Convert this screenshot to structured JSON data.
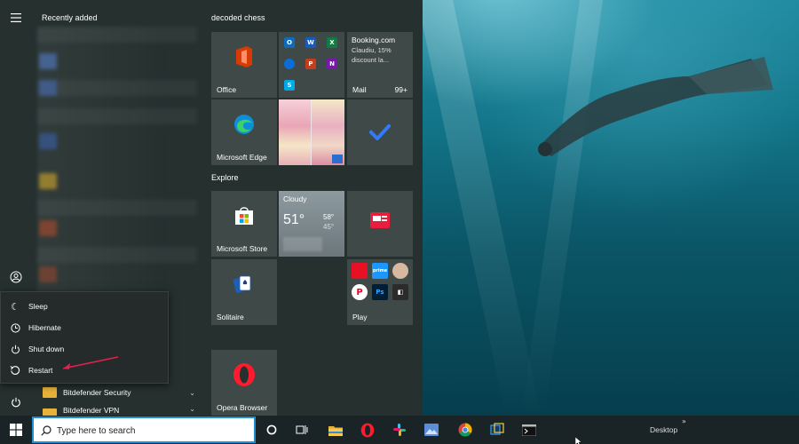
{
  "start_menu": {
    "recent_title": "Recently added",
    "group_decoded": "decoded chess",
    "group_explore": "Explore",
    "tiles": {
      "office": "Office",
      "mail": "Mail",
      "mail_count": "99+",
      "booking_title": "Booking.com",
      "booking_line1": "Claudiu, 15%",
      "booking_line2": "discount la...",
      "edge": "Microsoft Edge",
      "weather_condition": "Cloudy",
      "weather_temp": "51°",
      "weather_high": "58°",
      "weather_low": "45°",
      "store": "Microsoft Store",
      "solitaire": "Solitaire",
      "play": "Play",
      "opera": "Opera Browser"
    },
    "power_menu": {
      "sleep": "Sleep",
      "hibernate": "Hibernate",
      "shutdown": "Shut down",
      "restart": "Restart"
    },
    "app_list": [
      {
        "label": "Bitdefender Security"
      },
      {
        "label": "Bitdefender VPN"
      }
    ]
  },
  "taskbar": {
    "search_placeholder": "Type here to search",
    "desktop_label": "Desktop",
    "overflow": "»"
  },
  "colors": {
    "accent_blue": "#1e90d6",
    "office_red": "#d83b01",
    "restart_arrow": "#e0224e",
    "opera_red": "#ff1b2d"
  }
}
